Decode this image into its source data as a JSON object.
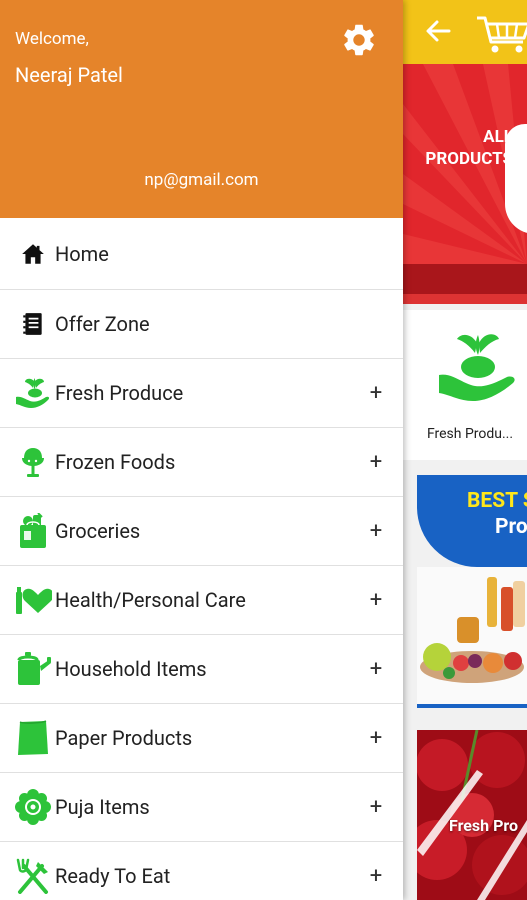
{
  "drawer": {
    "welcome": "Welcome,",
    "user_name": "Neeraj Patel",
    "email": "np@gmail.com",
    "header_color": "#E5842A",
    "settings_icon": "gear-icon"
  },
  "menu": {
    "items": [
      {
        "label": "Home",
        "icon": "home-icon",
        "expandable": false
      },
      {
        "label": "Offer Zone",
        "icon": "offer-book-icon",
        "expandable": false
      },
      {
        "label": "Fresh Produce",
        "icon": "fresh-produce-icon",
        "expandable": true,
        "expand_symbol": "+"
      },
      {
        "label": "Frozen Foods",
        "icon": "ice-cream-icon",
        "expandable": true,
        "expand_symbol": "+"
      },
      {
        "label": "Groceries",
        "icon": "grocery-bag-icon",
        "expandable": true,
        "expand_symbol": "+"
      },
      {
        "label": "Health/Personal Care",
        "icon": "health-care-icon",
        "expandable": true,
        "expand_symbol": "+"
      },
      {
        "label": "Household Items",
        "icon": "watering-can-icon",
        "expandable": true,
        "expand_symbol": "+"
      },
      {
        "label": "Paper Products",
        "icon": "paper-icon",
        "expandable": true,
        "expand_symbol": "+"
      },
      {
        "label": "Puja Items",
        "icon": "puja-flower-icon",
        "expandable": true,
        "expand_symbol": "+"
      },
      {
        "label": "Ready To Eat",
        "icon": "fork-knife-icon",
        "expandable": true,
        "expand_symbol": "+"
      }
    ],
    "icon_color": "#2DC33A"
  },
  "background": {
    "toolbar_color": "#F2C318",
    "banner_text": "ALL PRODUCTS",
    "category_label": "Fresh Produ...",
    "promo_line1": "BEST S",
    "promo_line2": "Pro",
    "fresh_banner_label": "Fresh Pro"
  }
}
